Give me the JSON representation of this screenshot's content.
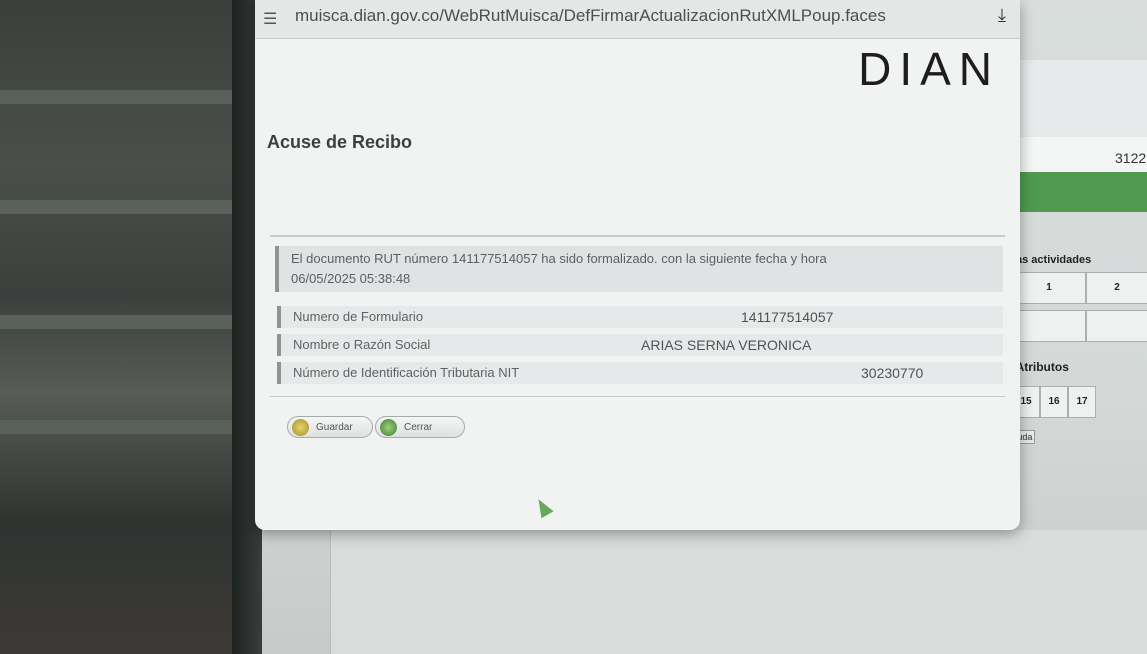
{
  "browser": {
    "url": "muisca.dian.gov.co/WebRutMuisca/DefFirmarActualizacionRutXMLPoup.faces"
  },
  "popup": {
    "logo_text": "DIAN",
    "title": "Acuse de Recibo",
    "message": "El documento RUT número 141177514057 ha sido formalizado. con la siguiente fecha y hora",
    "message_date": "06/05/2025 05:38:48",
    "fields": [
      {
        "label": "Numero de Formulario",
        "value": "141177514057"
      },
      {
        "label": "Nombre o Razón Social",
        "value": "ARIAS SERNA VERONICA"
      },
      {
        "label": "Número de Identificación Tributaria NIT",
        "value": "30230770"
      }
    ],
    "buttons": {
      "save": "Guardar",
      "close": "Cerrar"
    }
  },
  "background_app": {
    "number": "3122",
    "activities_label": "as actividades",
    "activity_cols": [
      "1",
      "2"
    ],
    "attributes_label": "y Atributos",
    "attribute_cols": [
      "15",
      "16",
      "17"
    ],
    "help_button": "Ayuda"
  },
  "colors": {
    "accent_green": "#4f9a4f",
    "popup_bg": "#f1f3f3"
  }
}
